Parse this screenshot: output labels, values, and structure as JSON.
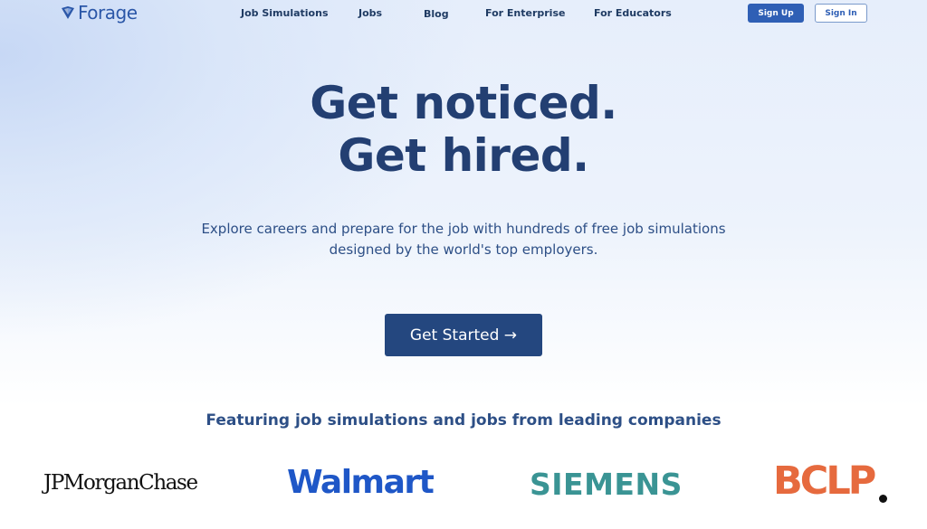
{
  "brand": {
    "name": "Forage",
    "icon": "forage-logo-icon",
    "color": "#2b57a8"
  },
  "nav": {
    "links": [
      "Job Simulations",
      "Jobs",
      "Blog",
      "For Enterprise",
      "For Educators"
    ],
    "signup_label": "Sign Up",
    "signin_label": "Sign In"
  },
  "hero": {
    "headline_line1": "Get noticed.",
    "headline_line2": "Get hired.",
    "subtitle_line1": "Explore careers and prepare for the job with hundreds of free job simulations",
    "subtitle_line2": "designed by the world's top employers.",
    "cta_label": "Get Started →"
  },
  "companies": {
    "heading": "Featuring job simulations and jobs from leading companies",
    "logos": [
      "JPMorganChase",
      "Walmart",
      "SIEMENS",
      "BCLP"
    ]
  },
  "colors": {
    "primary": "#24477f",
    "accent": "#2f5fb5",
    "headline": "#233f72",
    "walmart": "#1f57c7",
    "siemens": "#3a9494",
    "bclp": "#e66a3e"
  }
}
